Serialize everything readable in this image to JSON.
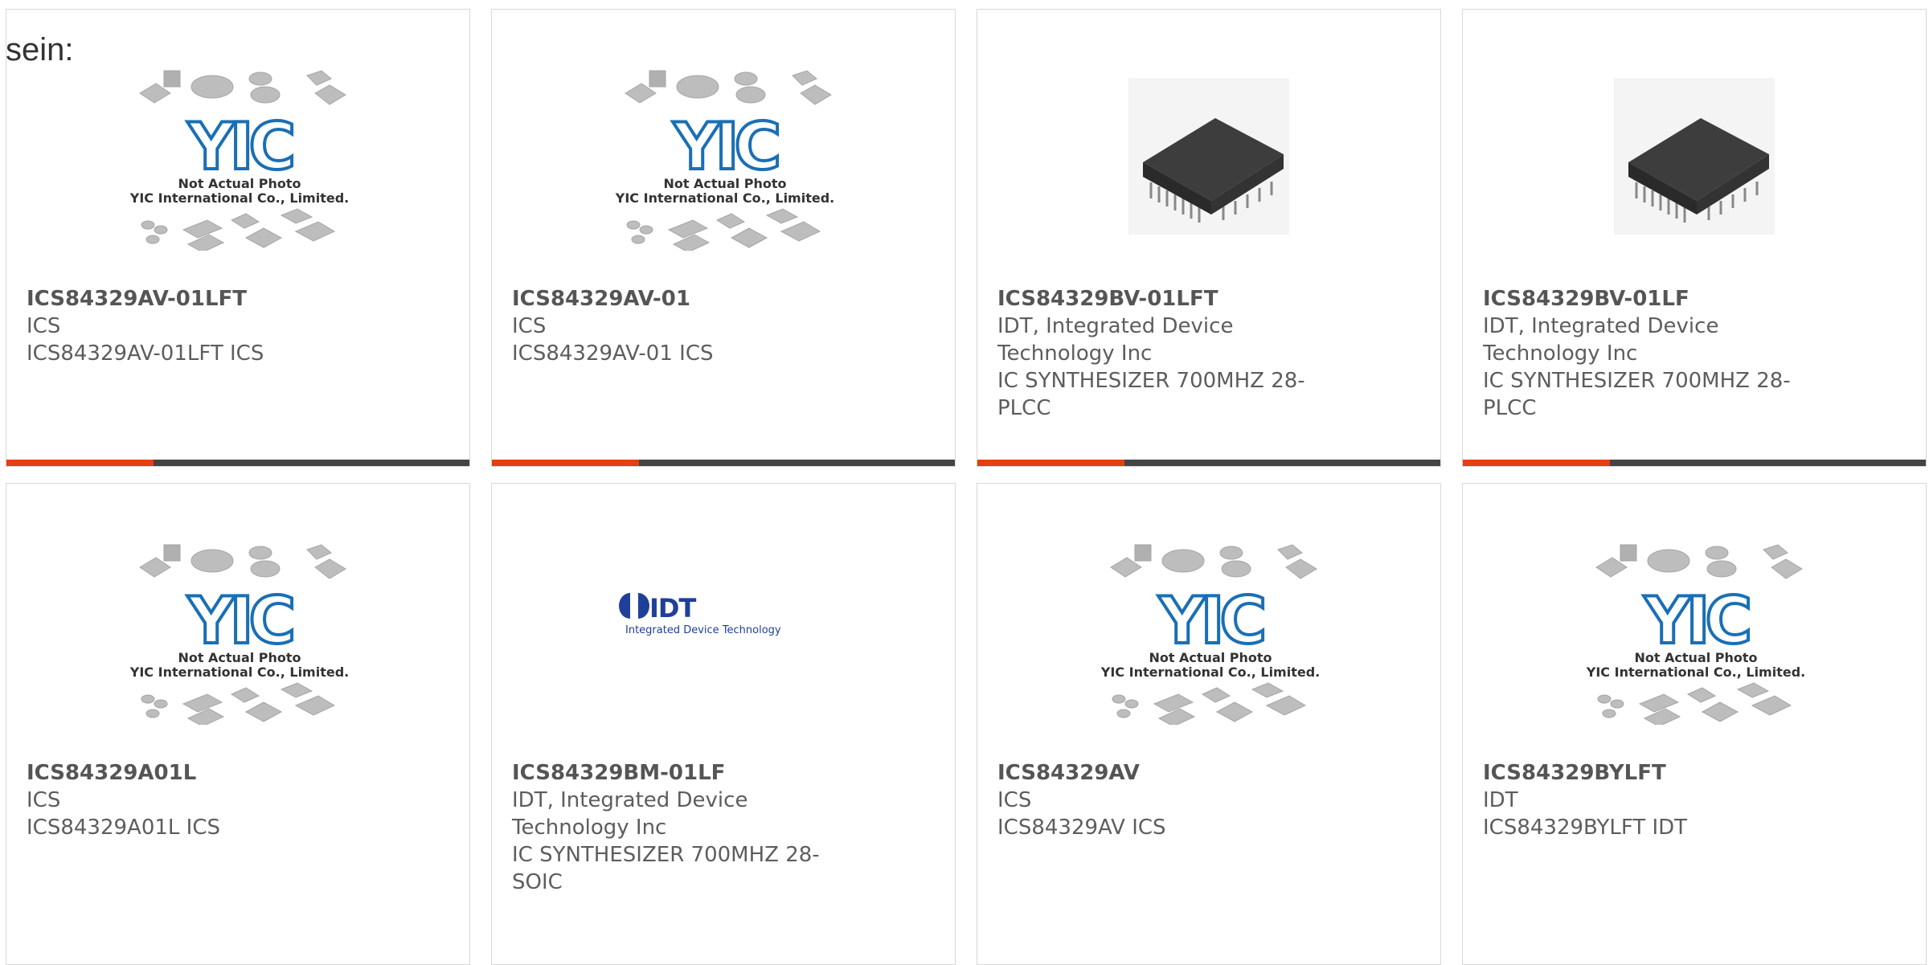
{
  "intro_text": "sein:",
  "placeholder_image": {
    "logo": "YIC",
    "caption_line1": "Not Actual Photo",
    "caption_line2": "YIC International Co., Limited."
  },
  "idt_logo": {
    "text": "IDT",
    "subtext": "Integrated Device Technology"
  },
  "colors": {
    "accent": "#e43f10",
    "bar": "#444444",
    "yic_blue": "#1a6fb5",
    "idt_blue": "#1f3f99"
  },
  "products": [
    {
      "part_number": "ICS84329AV-01LFT",
      "manufacturer": "ICS",
      "description": "ICS84329AV-01LFT ICS",
      "image": "placeholder-image"
    },
    {
      "part_number": "ICS84329AV-01",
      "manufacturer": "ICS",
      "description": "ICS84329AV-01 ICS",
      "image": "placeholder-image"
    },
    {
      "part_number": "ICS84329BV-01LFT",
      "manufacturer": "IDT, Integrated Device Technology Inc",
      "description": "IC SYNTHESIZER 700MHZ 28-PLCC",
      "image": "plcc-chip-photo"
    },
    {
      "part_number": "ICS84329BV-01LF",
      "manufacturer": "IDT, Integrated Device Technology Inc",
      "description": "IC SYNTHESIZER 700MHZ 28-PLCC",
      "image": "plcc-chip-photo"
    },
    {
      "part_number": "ICS84329A01L",
      "manufacturer": "ICS",
      "description": "ICS84329A01L ICS",
      "image": "placeholder-image"
    },
    {
      "part_number": "ICS84329BM-01LF",
      "manufacturer": "IDT, Integrated Device Technology Inc",
      "description": "IC SYNTHESIZER 700MHZ 28-SOIC",
      "image": "idt-logo"
    },
    {
      "part_number": "ICS84329AV",
      "manufacturer": "ICS",
      "description": "ICS84329AV ICS",
      "image": "placeholder-image"
    },
    {
      "part_number": "ICS84329BYLFT",
      "manufacturer": "IDT",
      "description": "ICS84329BYLFT IDT",
      "image": "placeholder-image"
    }
  ]
}
